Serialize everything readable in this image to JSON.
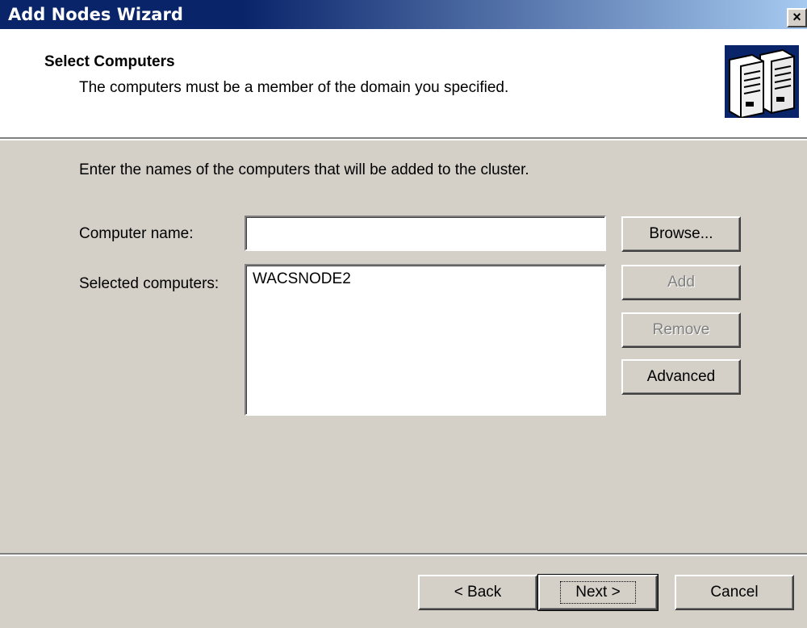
{
  "window": {
    "title": "Add Nodes Wizard",
    "close_label": "×"
  },
  "header": {
    "title": "Select Computers",
    "subtitle": "The computers must be a member of the domain you specified.",
    "icon": "server-cluster-icon"
  },
  "body": {
    "instruction": "Enter the names of the computers that will be added to the cluster.",
    "computer_name_label": "Computer name:",
    "computer_name_value": "",
    "selected_label": "Selected computers:",
    "selected_items": [
      "WACSNODE2"
    ]
  },
  "side_buttons": {
    "browse": "Browse...",
    "add": "Add",
    "remove": "Remove",
    "advanced": "Advanced"
  },
  "footer": {
    "back": "< Back",
    "next": "Next >",
    "cancel": "Cancel"
  },
  "colors": {
    "titlebar_start": "#0a246a",
    "titlebar_end": "#a6caf0",
    "face": "#d4d0c8",
    "disabled_text": "#808080"
  }
}
